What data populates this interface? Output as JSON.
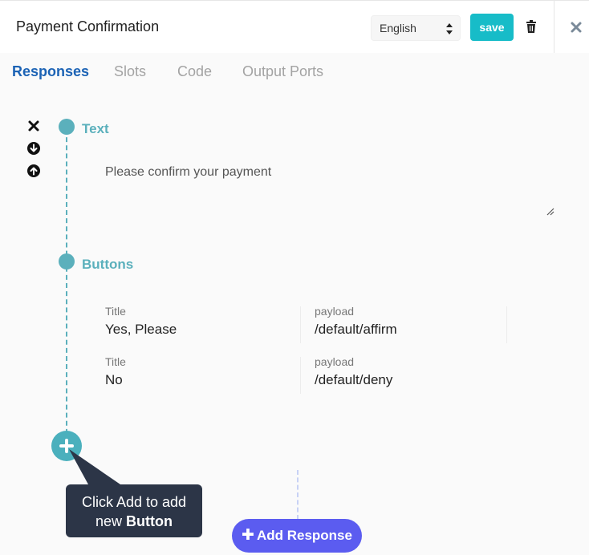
{
  "header": {
    "title": "Payment Confirmation",
    "language": "English",
    "save_label": "save"
  },
  "tabs": [
    {
      "label": "Responses",
      "active": true
    },
    {
      "label": "Slots",
      "active": false
    },
    {
      "label": "Code",
      "active": false
    },
    {
      "label": "Output Ports",
      "active": false
    }
  ],
  "sections": {
    "text": {
      "label": "Text",
      "value": "Please confirm your payment"
    },
    "buttons": {
      "label": "Buttons",
      "rows": [
        {
          "title_label": "Title",
          "title": "Yes, Please",
          "payload_label": "payload",
          "payload": "/default/affirm"
        },
        {
          "title_label": "Title",
          "title": "No",
          "payload_label": "payload",
          "payload": "/default/deny"
        }
      ]
    }
  },
  "tooltip": {
    "line1": "Click Add to add",
    "line2_prefix": "new ",
    "line2_bold": "Button"
  },
  "add_response_label": "Add Response",
  "colors": {
    "accent": "#17bcc8",
    "timeline": "#5bb0bc",
    "active_tab": "#1c63b5",
    "add_response": "#5b5cf0",
    "tooltip_bg": "#2c3547"
  }
}
